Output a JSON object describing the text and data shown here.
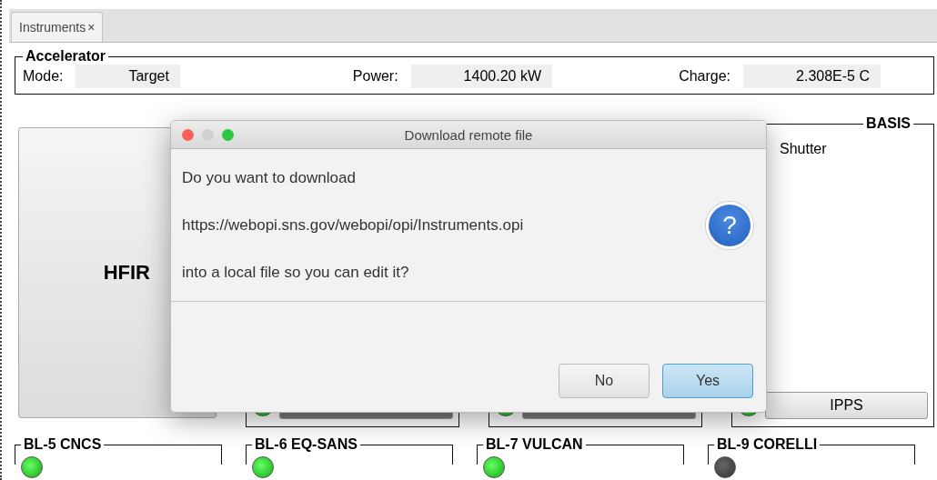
{
  "tab": {
    "label": "Instruments",
    "close": "×",
    "selected": true
  },
  "accelerator": {
    "title": "Accelerator",
    "fields": [
      {
        "label": "Mode:",
        "value": "Target"
      },
      {
        "label": "Power:",
        "value": "1400.20 kW"
      },
      {
        "label": "Charge:",
        "value": "2.308E-5 C"
      }
    ]
  },
  "hfir": {
    "label": "HFIR"
  },
  "top_panels": [
    {
      "led_on": true
    },
    {
      "led_on": true
    },
    {
      "title": "BASIS",
      "shutter": "Shutter",
      "led_on": true,
      "button": "IPPS"
    }
  ],
  "bottom_panels": [
    {
      "title": "BL-5 CNCS",
      "led_on": true
    },
    {
      "title": "BL-6 EQ-SANS",
      "led_on": true
    },
    {
      "title": "BL-7 VULCAN",
      "led_on": true
    },
    {
      "title": "BL-9 CORELLI",
      "led_on": false
    }
  ],
  "dialog": {
    "title": "Download remote file",
    "lines": [
      "Do you want to download",
      "https://webopi.sns.gov/webopi/opi/Instruments.opi",
      "into a local file so you can edit it?"
    ],
    "icon": "?",
    "buttons": [
      {
        "label": "No",
        "default": false
      },
      {
        "label": "Yes",
        "default": true
      }
    ]
  }
}
